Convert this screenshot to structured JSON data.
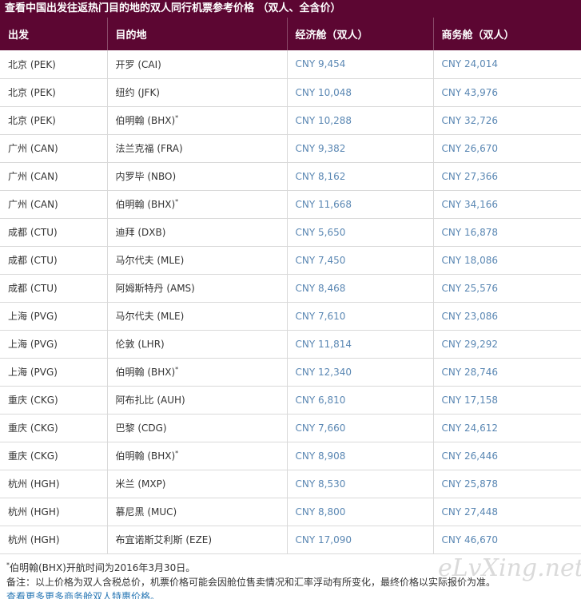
{
  "title": "查看中国出发往返热门目的地的双人同行机票参考价格 （双人、全含价）",
  "headers": [
    "出发",
    "目的地",
    "经济舱（双人）",
    "商务舱（双人）"
  ],
  "rows": [
    {
      "from": "北京 (PEK)",
      "to": "开罗 (CAI)",
      "note": "",
      "economy": "CNY 9,454",
      "business": "CNY 24,014"
    },
    {
      "from": "北京 (PEK)",
      "to": "纽约 (JFK)",
      "note": "",
      "economy": "CNY 10,048",
      "business": "CNY 43,976"
    },
    {
      "from": "北京 (PEK)",
      "to": "伯明翰 (BHX)",
      "note": "*",
      "economy": "CNY 10,288",
      "business": "CNY 32,726"
    },
    {
      "from": "广州 (CAN)",
      "to": "法兰克福 (FRA)",
      "note": "",
      "economy": "CNY 9,382",
      "business": "CNY 26,670"
    },
    {
      "from": "广州 (CAN)",
      "to": "内罗毕 (NBO)",
      "note": "",
      "economy": "CNY 8,162",
      "business": "CNY 27,366"
    },
    {
      "from": "广州 (CAN)",
      "to": "伯明翰 (BHX)",
      "note": "*",
      "economy": "CNY 11,668",
      "business": "CNY 34,166"
    },
    {
      "from": "成都 (CTU)",
      "to": "迪拜 (DXB)",
      "note": "",
      "economy": "CNY 5,650",
      "business": "CNY 16,878"
    },
    {
      "from": "成都 (CTU)",
      "to": "马尔代夫 (MLE)",
      "note": "",
      "economy": "CNY 7,450",
      "business": "CNY 18,086"
    },
    {
      "from": "成都 (CTU)",
      "to": "阿姆斯特丹 (AMS)",
      "note": "",
      "economy": "CNY 8,468",
      "business": "CNY 25,576"
    },
    {
      "from": "上海 (PVG)",
      "to": "马尔代夫 (MLE)",
      "note": "",
      "economy": "CNY 7,610",
      "business": "CNY 23,086"
    },
    {
      "from": "上海 (PVG)",
      "to": "伦敦 (LHR)",
      "note": "",
      "economy": "CNY 11,814",
      "business": "CNY 29,292"
    },
    {
      "from": "上海 (PVG)",
      "to": "伯明翰 (BHX)",
      "note": "*",
      "economy": "CNY 12,340",
      "business": "CNY 28,746"
    },
    {
      "from": "重庆 (CKG)",
      "to": "阿布扎比 (AUH)",
      "note": "",
      "economy": "CNY 6,810",
      "business": "CNY 17,158"
    },
    {
      "from": "重庆 (CKG)",
      "to": "巴黎 (CDG)",
      "note": "",
      "economy": "CNY 7,660",
      "business": "CNY 24,612"
    },
    {
      "from": "重庆 (CKG)",
      "to": "伯明翰 (BHX)",
      "note": "*",
      "economy": "CNY 8,908",
      "business": "CNY 26,446"
    },
    {
      "from": "杭州 (HGH)",
      "to": "米兰 (MXP)",
      "note": "",
      "economy": "CNY 8,530",
      "business": "CNY 25,878"
    },
    {
      "from": "杭州 (HGH)",
      "to": "慕尼黑 (MUC)",
      "note": "",
      "economy": "CNY 8,800",
      "business": "CNY 27,448"
    },
    {
      "from": "杭州 (HGH)",
      "to": "布宜诺斯艾利斯 (EZE)",
      "note": "",
      "economy": "CNY 17,090",
      "business": "CNY 46,670"
    }
  ],
  "footnote_mark": "*",
  "footnote_text": "伯明翰(BHX)开航时间为2016年3月30日。",
  "remark": "备注：以上价格为双人含税总价，机票价格可能会因舱位售卖情况和汇率浮动有所变化，最终价格以实际报价为准。",
  "more_link": "查看更多更多商务舱双人特惠价格。",
  "watermark": "eLvXing.net",
  "colors": {
    "header_bg": "#5c0632",
    "price_text": "#5a87b3",
    "link": "#2a78b5"
  }
}
